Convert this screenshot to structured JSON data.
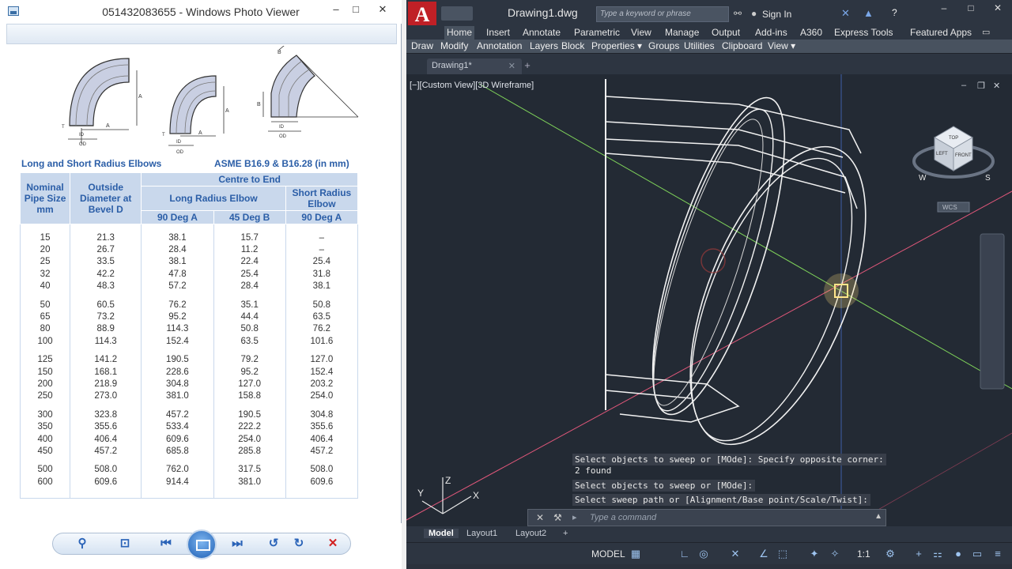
{
  "photo_viewer": {
    "title": "051432083655 - Windows Photo Viewer",
    "captions": {
      "left": "Long and Short Radius Elbows",
      "right": "ASME B16.9 & B16.28 (in mm)"
    },
    "table": {
      "h_nominal": "Nominal Pipe Size mm",
      "h_outside": "Outside Diameter at Bevel D",
      "h_centre": "Centre to End",
      "h_long": "Long Radius Elbow",
      "h_short": "Short Radius Elbow",
      "h_90a": "90 Deg A",
      "h_45b": "45 Deg B",
      "h_90a_short": "90 Deg A",
      "groups": [
        [
          [
            "15",
            "21.3",
            "38.1",
            "15.7",
            "–"
          ],
          [
            "20",
            "26.7",
            "28.4",
            "11.2",
            "–"
          ],
          [
            "25",
            "33.5",
            "38.1",
            "22.4",
            "25.4"
          ],
          [
            "32",
            "42.2",
            "47.8",
            "25.4",
            "31.8"
          ],
          [
            "40",
            "48.3",
            "57.2",
            "28.4",
            "38.1"
          ]
        ],
        [
          [
            "50",
            "60.5",
            "76.2",
            "35.1",
            "50.8"
          ],
          [
            "65",
            "73.2",
            "95.2",
            "44.4",
            "63.5"
          ],
          [
            "80",
            "88.9",
            "114.3",
            "50.8",
            "76.2"
          ],
          [
            "100",
            "114.3",
            "152.4",
            "63.5",
            "101.6"
          ]
        ],
        [
          [
            "125",
            "141.2",
            "190.5",
            "79.2",
            "127.0"
          ],
          [
            "150",
            "168.1",
            "228.6",
            "95.2",
            "152.4"
          ],
          [
            "200",
            "218.9",
            "304.8",
            "127.0",
            "203.2"
          ],
          [
            "250",
            "273.0",
            "381.0",
            "158.8",
            "254.0"
          ]
        ],
        [
          [
            "300",
            "323.8",
            "457.2",
            "190.5",
            "304.8"
          ],
          [
            "350",
            "355.6",
            "533.4",
            "222.2",
            "355.6"
          ],
          [
            "400",
            "406.4",
            "609.6",
            "254.0",
            "406.4"
          ],
          [
            "450",
            "457.2",
            "685.8",
            "285.8",
            "457.2"
          ]
        ],
        [
          [
            "500",
            "508.0",
            "762.0",
            "317.5",
            "508.0"
          ],
          [
            "600",
            "609.6",
            "914.4",
            "381.0",
            "609.6"
          ]
        ]
      ]
    },
    "diagram_labels": {
      "a": "A",
      "b": "B",
      "t": "T",
      "id": "ID",
      "od": "OD"
    },
    "controls": [
      "zoom-icon",
      "fit-icon",
      "previous-icon",
      "slideshow-icon",
      "next-icon",
      "rotate-ccw-icon",
      "rotate-cw-icon",
      "delete-icon"
    ]
  },
  "autocad": {
    "logo": "A",
    "doc_title": "Drawing1.dwg",
    "search_placeholder": "Type a keyword or phrase",
    "sign_in": "Sign In",
    "ribbon_tabs": [
      "Home",
      "Insert",
      "Annotate",
      "Parametric",
      "View",
      "Manage",
      "Output",
      "Add-ins",
      "A360",
      "Express Tools",
      "Featured Apps"
    ],
    "panels": [
      "Draw",
      "Modify",
      "Annotation",
      "Layers",
      "Block",
      "Properties ▾",
      "Groups",
      "Utilities",
      "Clipboard",
      "View ▾"
    ],
    "file_tab": "Drawing1*",
    "viewport_label": "[−][Custom View][3D Wireframe]",
    "viewcube": {
      "top": "TOP",
      "left": "LEFT",
      "front": "FRONT",
      "w": "W",
      "s": "S",
      "wcs": "WCS"
    },
    "ucs": {
      "x": "X",
      "y": "Y",
      "z": "Z"
    },
    "command_history": [
      "Select objects to sweep or [MOde]: Specify opposite corner:",
      "2 found",
      "Select objects to sweep or [MOde]:",
      "Select sweep path or [Alignment/Base point/Scale/Twist]:"
    ],
    "command_placeholder": "Type a command",
    "layout_tabs": [
      "Model",
      "Layout1",
      "Layout2"
    ],
    "status": {
      "model": "MODEL",
      "scale": "1:1"
    },
    "colors": {
      "x_axis": "#e0577a",
      "y_axis": "#7fd35a",
      "logo": "#c02026"
    }
  }
}
